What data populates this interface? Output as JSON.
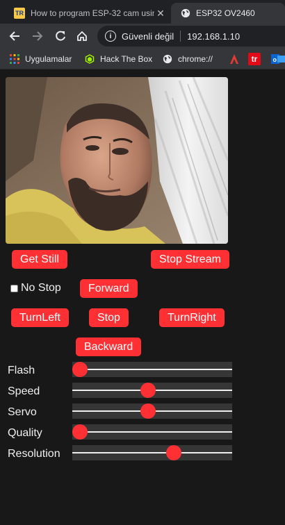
{
  "tabs": [
    {
      "title": "How to program ESP-32 cam usin",
      "favicon": "tr-icon"
    },
    {
      "title": "ESP32 OV2460",
      "favicon": "globe-icon"
    }
  ],
  "omnibox": {
    "security_label": "Güvenli değil",
    "url": "192.168.1.10"
  },
  "bookmarks": [
    {
      "label": "Uygulamalar",
      "icon": "apps-grid-icon"
    },
    {
      "label": "Hack The Box",
      "icon": "hackthebox-icon"
    },
    {
      "label": "chrome://",
      "icon": "globe-icon"
    }
  ],
  "bookmark_extras": {
    "tr_label": "tr"
  },
  "buttons": {
    "get_still": "Get Still",
    "stop_stream": "Stop Stream",
    "forward": "Forward",
    "turn_left": "TurnLeft",
    "stop": "Stop",
    "turn_right": "TurnRight",
    "backward": "Backward"
  },
  "no_stop": {
    "label": "No Stop",
    "checked": false
  },
  "sliders": [
    {
      "label": "Flash",
      "value": 0.0
    },
    {
      "label": "Speed",
      "value": 0.47
    },
    {
      "label": "Servo",
      "value": 0.47
    },
    {
      "label": "Quality",
      "value": 0.0
    },
    {
      "label": "Resolution",
      "value": 0.65
    }
  ],
  "colors": {
    "accent": "#ff3034",
    "page_bg": "#181818",
    "text": "#efefef"
  }
}
